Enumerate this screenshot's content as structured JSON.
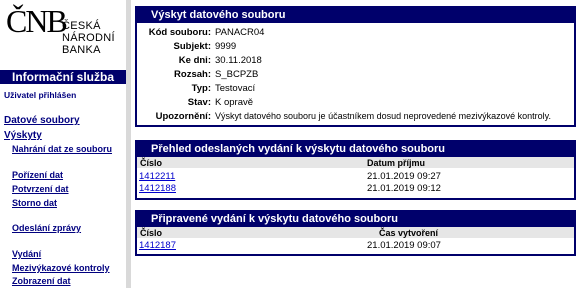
{
  "logo": {
    "mark": "ČNB",
    "line1": "ČESKÁ",
    "line2": "NÁRODNÍ",
    "line3": "BANKA"
  },
  "sidebar": {
    "service_title": "Informační služba",
    "user_login": "Uživatel přihlášen",
    "items": [
      {
        "label": "Datové soubory"
      },
      {
        "label": "Výskyty"
      },
      {
        "label": "Nahrání dat ze souboru"
      },
      {
        "label": "Pořízení dat"
      },
      {
        "label": "Potvrzení dat"
      },
      {
        "label": "Storno dat"
      },
      {
        "label": "Odeslání zprávy"
      },
      {
        "label": "Vydání"
      },
      {
        "label": "Mezivýkazové kontroly"
      },
      {
        "label": "Zobrazení dat"
      }
    ]
  },
  "occurrence": {
    "title": "Výskyt datového souboru",
    "fields": [
      {
        "label": "Kód souboru:",
        "value": "PANACR04"
      },
      {
        "label": "Subjekt:",
        "value": "9999"
      },
      {
        "label": "Ke dni:",
        "value": "30.11.2018"
      },
      {
        "label": "Rozsah:",
        "value": "S_BCPZB"
      },
      {
        "label": "Typ:",
        "value": "Testovací"
      },
      {
        "label": "Stav:",
        "value": "K opravě"
      },
      {
        "label": "Upozornění:",
        "value": "Výskyt datového souboru je účastníkem dosud neprovedené mezivýkazové kontroly."
      }
    ]
  },
  "sent_releases": {
    "title": "Přehled odeslaných vydání k výskytu datového souboru",
    "col_number": "Číslo",
    "col_date": "Datum příjmu",
    "rows": [
      {
        "number": "1412211",
        "date": "21.01.2019 09:27"
      },
      {
        "number": "1412188",
        "date": "21.01.2019 09:12"
      }
    ]
  },
  "prepared_releases": {
    "title": "Připravené vydání k výskytu datového souboru",
    "col_number": "Číslo",
    "col_created": "Čas vytvoření",
    "rows": [
      {
        "number": "1412187",
        "created": "21.01.2019 09:07"
      }
    ]
  }
}
